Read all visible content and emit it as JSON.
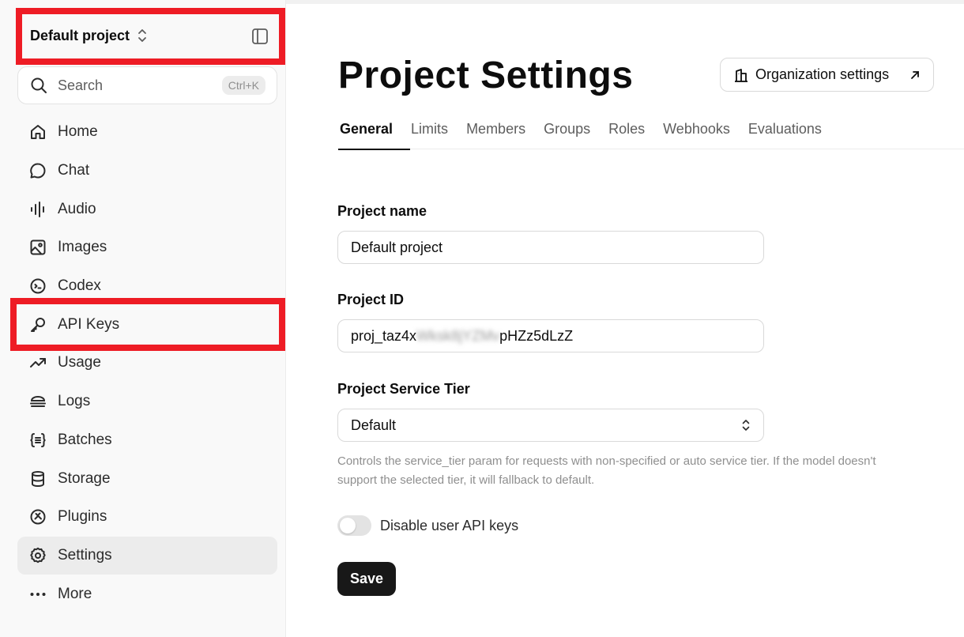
{
  "sidebar": {
    "project_name": "Default project",
    "search": {
      "label": "Search",
      "shortcut": "Ctrl+K"
    },
    "items": [
      {
        "label": "Home",
        "icon": "home-icon"
      },
      {
        "label": "Chat",
        "icon": "chat-icon"
      },
      {
        "label": "Audio",
        "icon": "audio-icon"
      },
      {
        "label": "Images",
        "icon": "images-icon"
      },
      {
        "label": "Codex",
        "icon": "codex-icon"
      },
      {
        "label": "API Keys",
        "icon": "key-icon"
      },
      {
        "label": "Usage",
        "icon": "usage-icon"
      },
      {
        "label": "Logs",
        "icon": "logs-icon"
      },
      {
        "label": "Batches",
        "icon": "batches-icon"
      },
      {
        "label": "Storage",
        "icon": "storage-icon"
      },
      {
        "label": "Plugins",
        "icon": "plugins-icon"
      },
      {
        "label": "Settings",
        "icon": "gear-icon",
        "active": true
      },
      {
        "label": "More",
        "icon": "more-icon"
      }
    ]
  },
  "header": {
    "title": "Project Settings",
    "org_button": "Organization settings"
  },
  "tabs": [
    {
      "label": "General",
      "active": true
    },
    {
      "label": "Limits"
    },
    {
      "label": "Members"
    },
    {
      "label": "Groups"
    },
    {
      "label": "Roles"
    },
    {
      "label": "Webhooks"
    },
    {
      "label": "Evaluations"
    }
  ],
  "form": {
    "project_name": {
      "label": "Project name",
      "value": "Default project"
    },
    "project_id": {
      "label": "Project ID",
      "value_prefix": "proj_taz4x",
      "value_hidden": "Wksk8jYZMv",
      "value_suffix": "pHZz5dLzZ"
    },
    "service_tier": {
      "label": "Project Service Tier",
      "value": "Default",
      "help": "Controls the service_tier param for requests with non-specified or auto service tier. If the model doesn't support the selected tier, it will fallback to default."
    },
    "disable_user_keys": {
      "label": "Disable user API keys",
      "enabled": false
    },
    "save_label": "Save"
  },
  "colors": {
    "highlight": "#ee1c25",
    "sidebar_bg": "#f9f9f9",
    "active_item_bg": "#ececec",
    "save_button_bg": "#181818"
  }
}
